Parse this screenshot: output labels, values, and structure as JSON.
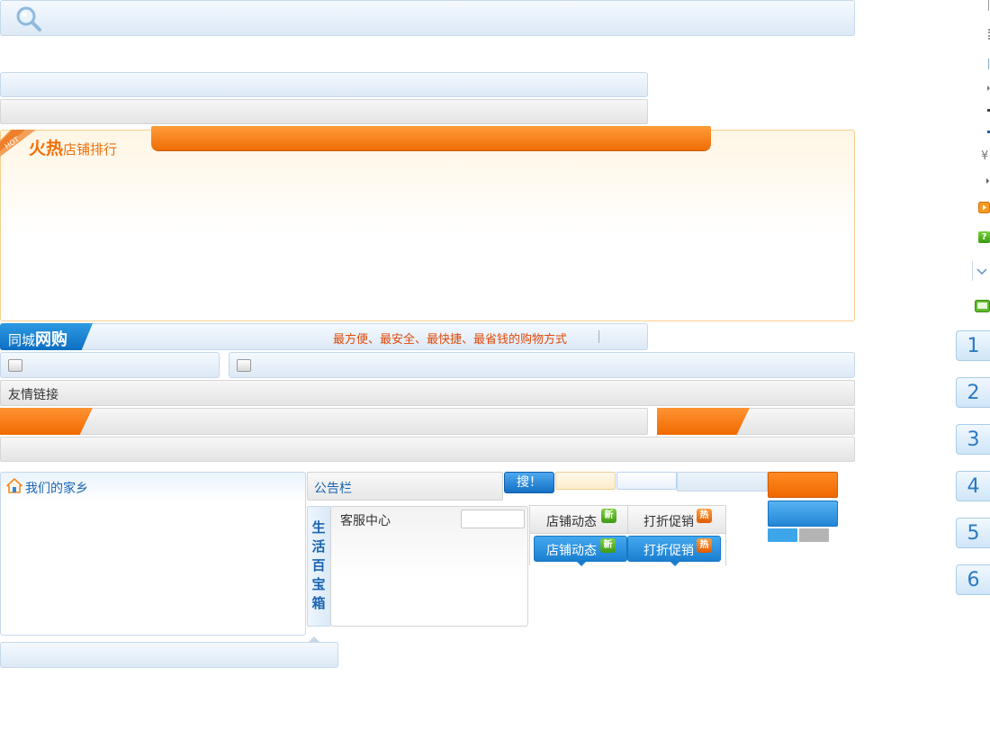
{
  "hot_section": {
    "ribbon": "HOT",
    "title_emphasis": "火热",
    "title_rest": "店铺排行"
  },
  "tongcheng": {
    "label_part1": "同城",
    "label_part2": "网购",
    "slogan": "最方便、最安全、最快捷、最省钱的购物方式"
  },
  "friend_links": {
    "label": "友情链接"
  },
  "hometown": {
    "label": "我们的家乡"
  },
  "notice_board": {
    "label": "公告栏"
  },
  "life_box": {
    "chars": [
      "生",
      "活",
      "百",
      "宝",
      "箱"
    ]
  },
  "customer_service": {
    "label": "客服中心",
    "input_value": ""
  },
  "tabs": {
    "inactive": [
      {
        "label": "店铺动态",
        "badge": "新"
      },
      {
        "label": "打折促销",
        "badge": "热"
      }
    ],
    "active": [
      {
        "label": "店铺动态",
        "badge": "新"
      },
      {
        "label": "打折促销",
        "badge": "热"
      }
    ]
  },
  "search_button": {
    "label": "搜！"
  },
  "edge_icons": {
    "currency": "¥",
    "badge_question": "?"
  },
  "page_numbers": [
    "1",
    "2",
    "3",
    "4",
    "5",
    "6"
  ],
  "colors": {
    "accent_orange": "#f06d05",
    "accent_blue": "#1a7fd0",
    "slogan_red": "#e04a07",
    "link_blue": "#1a64b3"
  }
}
